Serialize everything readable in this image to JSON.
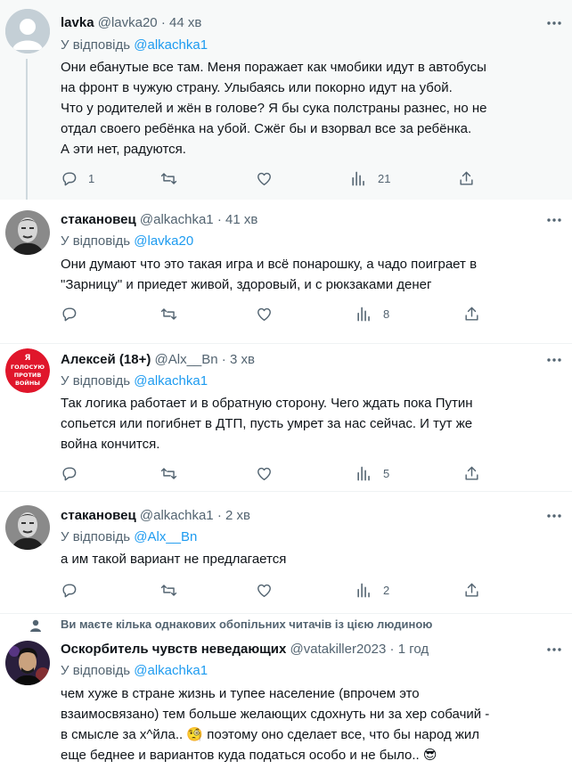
{
  "colors": {
    "text": "#0f1419",
    "secondary": "#536471",
    "link": "#1d9bf0",
    "thread_line": "#cfd9de"
  },
  "tweets": [
    {
      "name": "lavka",
      "handle": "@lavka20",
      "dot": "·",
      "time": "44 хв",
      "reply_prefix": "У відповідь",
      "reply_to": "@alkachka1",
      "lines": [
        "Они ебанутые все там. Меня поражает как чмобики идут в автобусы",
        "на фронт в чужую страну. Улыбаясь или покорно идут на убой.",
        "Что у родителей и жён в голове? Я бы сука полстраны разнес, но не",
        "отдал своего ребёнка на убой. Сжёг бы и взорвал все за ребёнка.",
        "А эти нет, радуются."
      ],
      "reply_count": "1",
      "retweet_count": "",
      "like_count": "",
      "views_count": "21"
    },
    {
      "name": "стакановец",
      "handle": "@alkachka1",
      "dot": "·",
      "time": "41 хв",
      "reply_prefix": "У відповідь",
      "reply_to": "@lavka20",
      "lines": [
        "Они думают что это такая игра и всё понарошку, а чадо поиграет в",
        "\"Зарницу\" и приедет живой, здоровый, и с рюкзаками денег"
      ],
      "reply_count": "",
      "retweet_count": "",
      "like_count": "",
      "views_count": "8"
    },
    {
      "name": "Алексей (18+)",
      "handle": "@Alx__Bn",
      "dot": "·",
      "time": "3 хв",
      "reply_prefix": "У відповідь",
      "reply_to": "@alkachka1",
      "lines": [
        "Так логика работает и в обратную сторону. Чего ждать пока Путин",
        "сопьется или погибнет в ДТП, пусть умрет за нас сейчас. И тут же",
        "война кончится."
      ],
      "reply_count": "",
      "retweet_count": "",
      "like_count": "",
      "views_count": "5"
    },
    {
      "name": "стакановец",
      "handle": "@alkachka1",
      "dot": "·",
      "time": "2 хв",
      "reply_prefix": "У відповідь",
      "reply_to": "@Alx__Bn",
      "lines": [
        "а им такой вариант не предлагается"
      ],
      "reply_count": "",
      "retweet_count": "",
      "like_count": "",
      "views_count": "2"
    },
    {
      "name": "Оскорбитель чувств неведающих",
      "handle": "@vatakiller2023",
      "dot": "·",
      "time": "1 год",
      "reply_prefix": "У відповідь",
      "reply_to": "@alkachka1",
      "lines": [
        "чем хуже в стране жизнь и тупее население (впрочем это",
        "взаимосвязано) тем больше желающих сдохнуть ни за хер собачий -",
        "в смысле за х^йла.. 🧐 поэтому оно сделает все, что бы народ жил",
        "еще беднее и вариантов куда податься особо и не было.. 😎"
      ]
    }
  ],
  "mutual_notice": "Ви маєте кілька однакових обопільних читачів із цією людиною",
  "avatar3_badge": [
    "Я",
    "ГОЛОСУЮ",
    "ПРОТИВ",
    "ВОЙНЫ"
  ],
  "icons": [
    "reply-icon",
    "retweet-icon",
    "like-icon",
    "views-icon",
    "share-icon",
    "more-icon",
    "person-icon"
  ]
}
